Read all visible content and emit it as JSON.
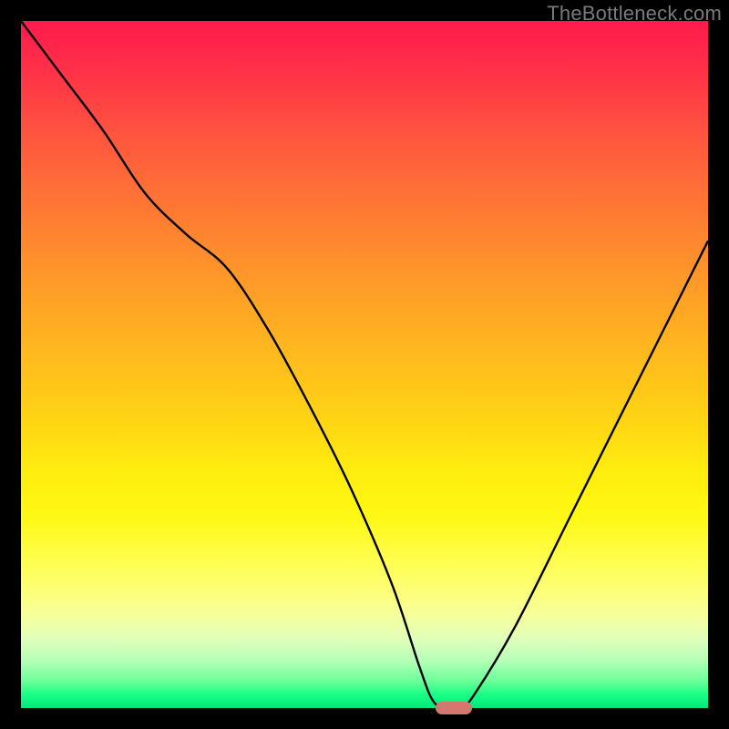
{
  "watermark": "TheBottleneck.com",
  "colors": {
    "frame_border": "#000000",
    "curve_stroke": "#000000",
    "marker_fill": "#d4776f"
  },
  "chart_data": {
    "type": "line",
    "title": "",
    "xlabel": "",
    "ylabel": "",
    "xlim": [
      0,
      100
    ],
    "ylim": [
      0,
      100
    ],
    "grid": false,
    "legend": false,
    "series": [
      {
        "name": "bottleneck-curve",
        "x": [
          0,
          6,
          12,
          18,
          24,
          30,
          36,
          42,
          48,
          54,
          58,
          60,
          62,
          64,
          66,
          72,
          80,
          90,
          100
        ],
        "y": [
          100,
          92,
          84,
          75,
          69,
          64,
          55,
          44,
          32,
          18,
          6,
          1,
          0,
          0,
          2,
          12,
          28,
          48,
          68
        ]
      }
    ],
    "annotations": [
      {
        "name": "optimal-marker",
        "x": 63,
        "y": 0,
        "shape": "pill"
      }
    ],
    "background_gradient": {
      "top": "#ff1a4d",
      "mid": "#ffee0f",
      "bottom": "#00e87a"
    }
  }
}
